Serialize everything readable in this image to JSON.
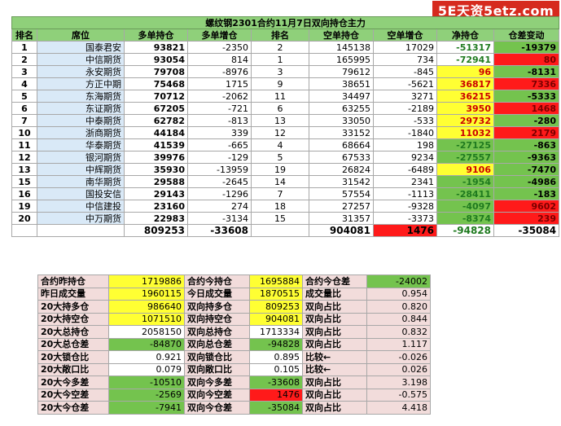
{
  "logo": "5E天资5etz.com",
  "title": "螺纹钢2301合约11月7日双向持仓主力",
  "headers": [
    "排名",
    "席位",
    "多单持仓",
    "多单增仓",
    "排名",
    "空单持仓",
    "空单增仓",
    "净持仓",
    "仓差变动"
  ],
  "rows": [
    {
      "rank": "1",
      "broker": "国泰君安",
      "long": "93821",
      "long_chg": "-2350",
      "srank": "2",
      "short": "145138",
      "short_chg": "17029",
      "net": "-51317",
      "diff": "-19379",
      "net_bg": "#ffffff",
      "diff_bg": "#74c34e"
    },
    {
      "rank": "2",
      "broker": "中信期货",
      "long": "93054",
      "long_chg": "814",
      "srank": "1",
      "short": "165995",
      "short_chg": "734",
      "net": "-72941",
      "diff": "80",
      "net_bg": "#ffffff",
      "diff_bg": "#ff1a1a"
    },
    {
      "rank": "3",
      "broker": "永安期货",
      "long": "79708",
      "long_chg": "-8976",
      "srank": "3",
      "short": "79612",
      "short_chg": "-845",
      "net": "96",
      "diff": "-8131",
      "net_bg": "#ffff33",
      "diff_bg": "#74c34e"
    },
    {
      "rank": "4",
      "broker": "方正中期",
      "long": "75468",
      "long_chg": "1715",
      "srank": "9",
      "short": "38651",
      "short_chg": "-5621",
      "net": "36817",
      "diff": "7336",
      "net_bg": "#ffff33",
      "diff_bg": "#ff1a1a"
    },
    {
      "rank": "5",
      "broker": "东海期货",
      "long": "70712",
      "long_chg": "-2062",
      "srank": "11",
      "short": "34497",
      "short_chg": "3271",
      "net": "36215",
      "diff": "-5333",
      "net_bg": "#ffff33",
      "diff_bg": "#74c34e"
    },
    {
      "rank": "6",
      "broker": "东证期货",
      "long": "67205",
      "long_chg": "-721",
      "srank": "6",
      "short": "63255",
      "short_chg": "-2189",
      "net": "3950",
      "diff": "1468",
      "net_bg": "#ffff33",
      "diff_bg": "#ff1a1a"
    },
    {
      "rank": "7",
      "broker": "中泰期货",
      "long": "62782",
      "long_chg": "-813",
      "srank": "13",
      "short": "33050",
      "short_chg": "-533",
      "net": "29732",
      "diff": "-280",
      "net_bg": "#ffff33",
      "diff_bg": "#74c34e"
    },
    {
      "rank": "10",
      "broker": "浙商期货",
      "long": "44184",
      "long_chg": "339",
      "srank": "12",
      "short": "33152",
      "short_chg": "-1840",
      "net": "11032",
      "diff": "2179",
      "net_bg": "#ffff33",
      "diff_bg": "#ff1a1a"
    },
    {
      "rank": "11",
      "broker": "华泰期货",
      "long": "41539",
      "long_chg": "-665",
      "srank": "4",
      "short": "68664",
      "short_chg": "198",
      "net": "-27125",
      "diff": "-863",
      "net_bg": "#74c34e",
      "diff_bg": "#74c34e"
    },
    {
      "rank": "12",
      "broker": "银河期货",
      "long": "39976",
      "long_chg": "-129",
      "srank": "5",
      "short": "67533",
      "short_chg": "9234",
      "net": "-27557",
      "diff": "-9363",
      "net_bg": "#74c34e",
      "diff_bg": "#74c34e"
    },
    {
      "rank": "13",
      "broker": "中辉期货",
      "long": "35930",
      "long_chg": "-13959",
      "srank": "19",
      "short": "26824",
      "short_chg": "-6489",
      "net": "9106",
      "diff": "-7470",
      "net_bg": "#ffff33",
      "diff_bg": "#74c34e"
    },
    {
      "rank": "15",
      "broker": "南华期货",
      "long": "29588",
      "long_chg": "-2645",
      "srank": "14",
      "short": "31542",
      "short_chg": "2341",
      "net": "-1954",
      "diff": "-4986",
      "net_bg": "#74c34e",
      "diff_bg": "#74c34e"
    },
    {
      "rank": "16",
      "broker": "国投安信",
      "long": "29143",
      "long_chg": "-1296",
      "srank": "7",
      "short": "57554",
      "short_chg": "-1113",
      "net": "-28411",
      "diff": "-183",
      "net_bg": "#74c34e",
      "diff_bg": "#74c34e"
    },
    {
      "rank": "19",
      "broker": "中信建投",
      "long": "23160",
      "long_chg": "274",
      "srank": "18",
      "short": "27257",
      "short_chg": "-9328",
      "net": "-4097",
      "diff": "9602",
      "net_bg": "#74c34e",
      "diff_bg": "#ff1a1a"
    },
    {
      "rank": "20",
      "broker": "中万期货",
      "long": "22983",
      "long_chg": "-3134",
      "srank": "15",
      "short": "31357",
      "short_chg": "-3373",
      "net": "-8374",
      "diff": "239",
      "net_bg": "#74c34e",
      "diff_bg": "#ff1a1a"
    }
  ],
  "totals": {
    "long": "809253",
    "long_chg": "-33608",
    "short": "904081",
    "short_chg": "1476",
    "net": "-94828",
    "diff": "-35084"
  },
  "stats": [
    {
      "l1": "合约昨持仓",
      "v1": "1719886",
      "v1_bg": "#ffff33",
      "l2": "合约今持仓",
      "v2": "1695884",
      "v2_bg": "#ffff33",
      "l3": "合约今仓差",
      "v3": "-24002",
      "v3_bg": "#74c34e"
    },
    {
      "l1": "昨日成交量",
      "v1": "1960115",
      "v1_bg": "#ffff33",
      "l2": "今日成交量",
      "v2": "1870515",
      "v2_bg": "#ffff33",
      "l3": "成交量比",
      "v3": "0.954",
      "v3_bg": "#f2dcdb"
    },
    {
      "l1": "20大持多仓",
      "v1": "986640",
      "v1_bg": "#ffff33",
      "l2": "双向持多仓",
      "v2": "809253",
      "v2_bg": "#ffff33",
      "l3": "双向占比",
      "v3": "0.820",
      "v3_bg": "#f2dcdb"
    },
    {
      "l1": "20大持空仓",
      "v1": "1071510",
      "v1_bg": "#ffff33",
      "l2": "双向持空仓",
      "v2": "904081",
      "v2_bg": "#ffff33",
      "l3": "双向占比",
      "v3": "0.844",
      "v3_bg": "#f2dcdb"
    },
    {
      "l1": "20大总持仓",
      "v1": "2058150",
      "v1_bg": "#ffffff",
      "l2": "双向总持仓",
      "v2": "1713334",
      "v2_bg": "#ffffff",
      "l3": "双向占比",
      "v3": "0.832",
      "v3_bg": "#f2dcdb"
    },
    {
      "l1": "20大总仓差",
      "v1": "-84870",
      "v1_bg": "#74c34e",
      "l2": "双向总仓差",
      "v2": "-94828",
      "v2_bg": "#74c34e",
      "l3": "双向占比",
      "v3": "1.117",
      "v3_bg": "#f2dcdb"
    },
    {
      "l1": "20大锁仓比",
      "v1": "0.921",
      "v1_bg": "#ffffff",
      "l2": "双向锁仓比",
      "v2": "0.895",
      "v2_bg": "#ffffff",
      "l3": "比较←",
      "v3": "-0.026",
      "v3_bg": "#f2dcdb"
    },
    {
      "l1": "20大敞口比",
      "v1": "0.079",
      "v1_bg": "#ffffff",
      "l2": "双向敞口比",
      "v2": "0.105",
      "v2_bg": "#ffffff",
      "l3": "比较←",
      "v3": "0.026",
      "v3_bg": "#f2dcdb"
    },
    {
      "l1": "20大今多差",
      "v1": "-10510",
      "v1_bg": "#74c34e",
      "l2": "双向今多差",
      "v2": "-33608",
      "v2_bg": "#74c34e",
      "l3": "双向占比",
      "v3": "3.198",
      "v3_bg": "#f2dcdb"
    },
    {
      "l1": "20大今空差",
      "v1": "-2569",
      "v1_bg": "#74c34e",
      "l2": "双向今空差",
      "v2": "1476",
      "v2_bg": "#ff1a1a",
      "l3": "双向占比",
      "v3": "-0.575",
      "v3_bg": "#f2dcdb"
    },
    {
      "l1": "20大今仓差",
      "v1": "-7941",
      "v1_bg": "#74c34e",
      "l2": "双向今仓差",
      "v2": "-35084",
      "v2_bg": "#74c34e",
      "l3": "双向占比",
      "v3": "4.418",
      "v3_bg": "#f2dcdb"
    }
  ]
}
